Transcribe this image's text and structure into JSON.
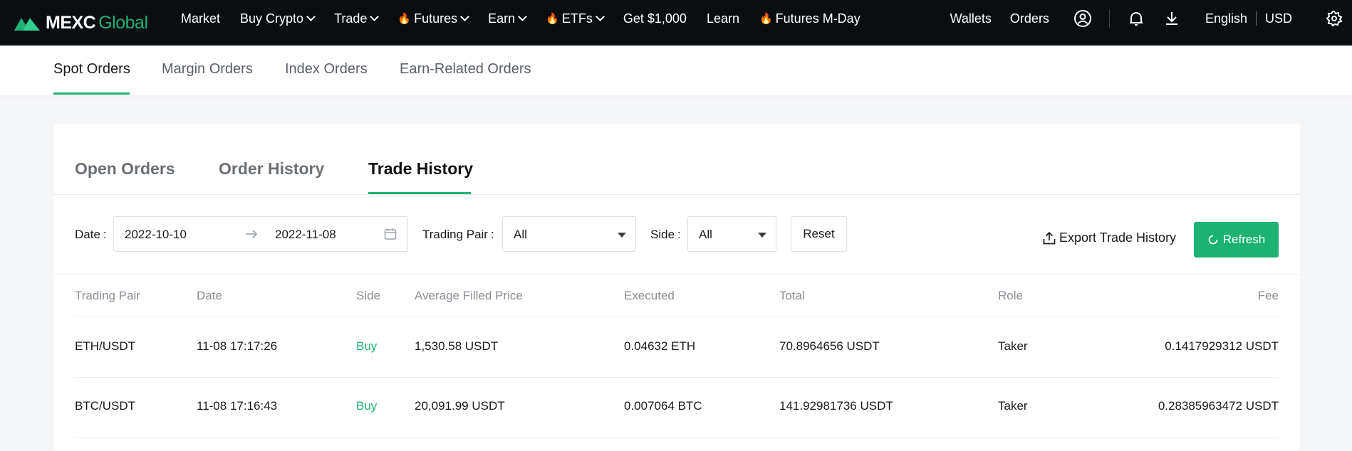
{
  "brand": {
    "name": "MEXC",
    "suffix": "Global",
    "accent": "#1bb273",
    "navbar_bg": "#0b0e11"
  },
  "topnav": {
    "items": [
      {
        "label": "Market",
        "dropdown": false,
        "hot": false
      },
      {
        "label": "Buy Crypto",
        "dropdown": true,
        "hot": false
      },
      {
        "label": "Trade",
        "dropdown": true,
        "hot": false
      },
      {
        "label": "Futures",
        "dropdown": true,
        "hot": true
      },
      {
        "label": "Earn",
        "dropdown": true,
        "hot": false
      },
      {
        "label": "ETFs",
        "dropdown": true,
        "hot": true
      },
      {
        "label": "Get $1,000",
        "dropdown": false,
        "hot": false
      },
      {
        "label": "Learn",
        "dropdown": false,
        "hot": false
      },
      {
        "label": "Futures M-Day",
        "dropdown": false,
        "hot": true
      }
    ],
    "wallets": "Wallets",
    "orders": "Orders",
    "language": "English",
    "currency": "USD",
    "icons": [
      "user-icon",
      "bell-icon",
      "download-icon",
      "gear-icon"
    ]
  },
  "subtabs": {
    "items": [
      "Spot Orders",
      "Margin Orders",
      "Index Orders",
      "Earn-Related Orders"
    ],
    "active": "Spot Orders"
  },
  "maintabs": {
    "items": [
      "Open Orders",
      "Order History",
      "Trade History"
    ],
    "active": "Trade History"
  },
  "filters": {
    "date_label": "Date",
    "date_start": "2022-10-10",
    "date_end": "2022-11-08",
    "pair_label": "Trading Pair",
    "pair_value": "All",
    "side_label": "Side",
    "side_value": "All",
    "reset_label": "Reset",
    "export_label": "Export Trade History",
    "refresh_label": "Refresh"
  },
  "table": {
    "columns": [
      "Trading Pair",
      "Date",
      "Side",
      "Average Filled Price",
      "Executed",
      "Total",
      "Role",
      "Fee"
    ],
    "rows": [
      {
        "pair": "ETH/USDT",
        "date": "11-08 17:17:26",
        "side": "Buy",
        "price": "1,530.58 USDT",
        "executed": "0.04632 ETH",
        "total": "70.8964656 USDT",
        "role": "Taker",
        "fee": "0.1417929312 USDT"
      },
      {
        "pair": "BTC/USDT",
        "date": "11-08 17:16:43",
        "side": "Buy",
        "price": "20,091.99 USDT",
        "executed": "0.007064 BTC",
        "total": "141.92981736 USDT",
        "role": "Taker",
        "fee": "0.28385963472 USDT"
      }
    ]
  }
}
